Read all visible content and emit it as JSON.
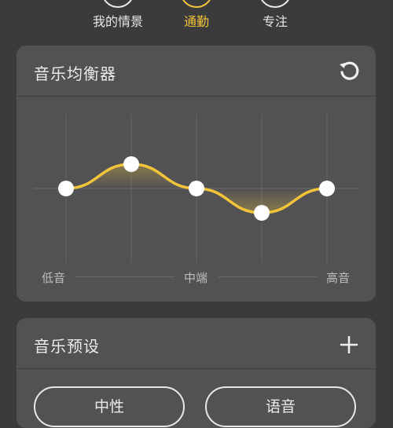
{
  "scene_tabs": [
    {
      "label": "我的情景",
      "active": false
    },
    {
      "label": "通勤",
      "active": true
    },
    {
      "label": "专注",
      "active": false
    }
  ],
  "equalizer": {
    "title": "音乐均衡器",
    "reset_icon": "reset-icon",
    "labels": {
      "low": "低音",
      "mid": "中端",
      "high": "高音"
    },
    "bands": [
      0,
      1,
      0,
      -1,
      0
    ],
    "curve_color": "#f2c43a"
  },
  "presets": {
    "title": "音乐预设",
    "add_icon": "plus-icon",
    "items": [
      "中性",
      "语音"
    ]
  },
  "colors": {
    "accent": "#f2c43a",
    "background": "#3b3b3d",
    "card": "#525254"
  }
}
